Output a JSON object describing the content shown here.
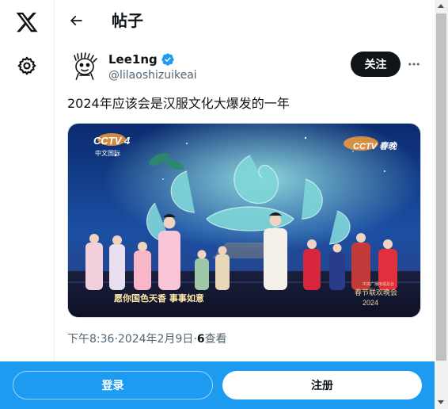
{
  "sidebar": {
    "logo_icon": "x-logo-icon",
    "settings_icon": "gear-icon"
  },
  "header": {
    "title": "帖子",
    "back_icon": "arrow-left-icon"
  },
  "post": {
    "author": {
      "display_name": "Lee1ng",
      "handle": "@lilaoshizuikeai",
      "verified": true
    },
    "follow_label": "关注",
    "text": "2024年应该会是汉服文化大爆发的一年",
    "media": {
      "channel_logo": "CCTV 4",
      "channel_sub": "中文国际",
      "channel_logo_right": "CCTV 春晚",
      "caption_left": "愿你国色天香 事事如意",
      "caption_right_top": "中央广播电视总台",
      "caption_right_mid": "春节联欢晚会",
      "caption_right_year": "2024"
    },
    "meta": {
      "time": "下午8:36",
      "sep1": " · ",
      "date": "2024年2月9日",
      "sep2": " · ",
      "views_count": "6",
      "views_label": " 查看"
    }
  },
  "bottom_bar": {
    "login_label": "登录",
    "signup_label": "注册"
  },
  "colors": {
    "accent": "#1d9bf0",
    "text_primary": "#0f1419",
    "text_secondary": "#536471",
    "follow_bg": "#0f1419"
  }
}
